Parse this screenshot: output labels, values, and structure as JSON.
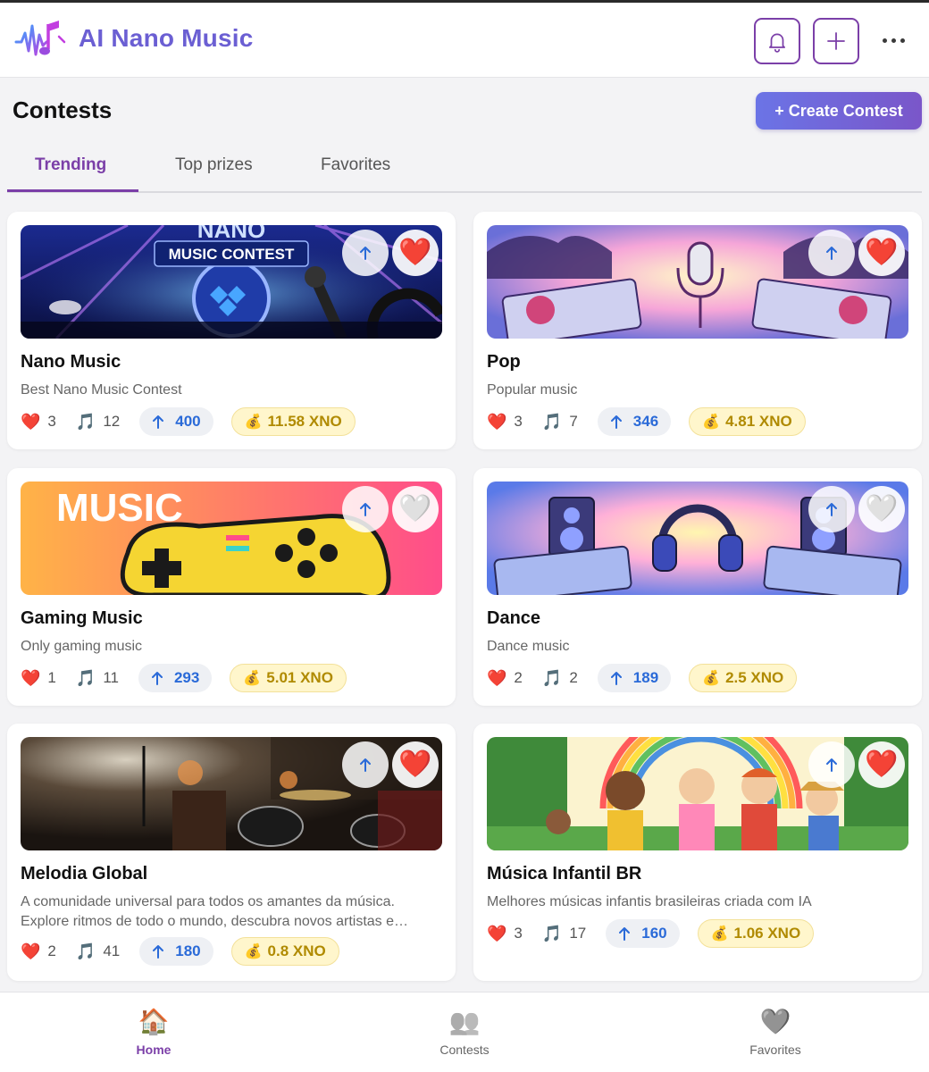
{
  "app": {
    "title": "AI Nano Music"
  },
  "page": {
    "title": "Contests",
    "create_label": "+ Create Contest"
  },
  "tabs": [
    {
      "label": "Trending",
      "active": true
    },
    {
      "label": "Top prizes",
      "active": false
    },
    {
      "label": "Favorites",
      "active": false
    }
  ],
  "contests": [
    {
      "title": "Nano Music",
      "description": "Best Nano Music Contest",
      "likes": "3",
      "tracks": "12",
      "votes": "400",
      "prize": "11.58 XNO",
      "favorited": true,
      "banner_text": "MUSIC CONTEST",
      "banner_top_text": "NANO"
    },
    {
      "title": "Pop",
      "description": "Popular music",
      "likes": "3",
      "tracks": "7",
      "votes": "346",
      "prize": "4.81 XNO",
      "favorited": true
    },
    {
      "title": "Gaming Music",
      "description": "Only gaming music",
      "likes": "1",
      "tracks": "11",
      "votes": "293",
      "prize": "5.01 XNO",
      "favorited": false,
      "banner_text": "MUSIC"
    },
    {
      "title": "Dance",
      "description": "Dance music",
      "likes": "2",
      "tracks": "2",
      "votes": "189",
      "prize": "2.5 XNO",
      "favorited": false
    },
    {
      "title": "Melodia Global",
      "description": "A comunidade universal para todos os amantes da música. Explore ritmos de todo o mundo, descubra novos artistas e…",
      "likes": "2",
      "tracks": "41",
      "votes": "180",
      "prize": "0.8 XNO",
      "favorited": true
    },
    {
      "title": "Música Infantil BR",
      "description": "Melhores músicas infantis brasileiras criada com IA",
      "likes": "3",
      "tracks": "17",
      "votes": "160",
      "prize": "1.06 XNO",
      "favorited": true
    }
  ],
  "icons": {
    "heart_filled": "❤️",
    "heart_empty": "🤍",
    "note": "🎵",
    "money_bag": "💰"
  },
  "bottom_nav": [
    {
      "label": "Home",
      "icon": "🏠",
      "active": true
    },
    {
      "label": "Contests",
      "icon": "👥",
      "active": false
    },
    {
      "label": "Favorites",
      "icon": "🩶",
      "active": false
    }
  ],
  "colors": {
    "brand": "#6b5fd3",
    "accent": "#7b3fa8",
    "vote": "#2a6ad8",
    "prize": "#b08a00"
  }
}
